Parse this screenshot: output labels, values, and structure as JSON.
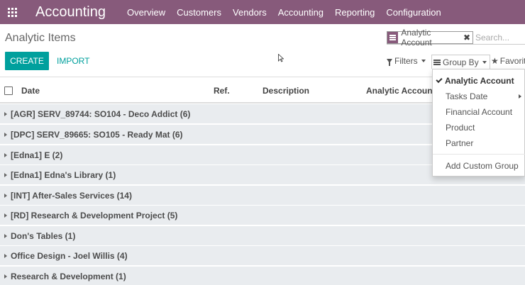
{
  "navbar": {
    "brand": "Accounting",
    "menu": [
      "Overview",
      "Customers",
      "Vendors",
      "Accounting",
      "Reporting",
      "Configuration"
    ]
  },
  "breadcrumb": "Analytic Items",
  "search": {
    "facet_label": "Analytic Account",
    "facet_close": "✖",
    "placeholder": "Search..."
  },
  "buttons": {
    "create": "CREATE",
    "import": "IMPORT"
  },
  "toolbar": {
    "filters": "Filters",
    "group_by": "Group By",
    "favorites": "Favorites"
  },
  "columns": {
    "date": "Date",
    "ref": "Ref.",
    "description": "Description",
    "analytic_account": "Analytic Account"
  },
  "groups": [
    "[AGR] SERV_89744: SO104 - Deco Addict (6)",
    "[DPC] SERV_89665: SO105 - Ready Mat (6)",
    "[Edna1] E (2)",
    "[Edna1] Edna's Library (1)",
    "[INT] After-Sales Services (14)",
    "[RD] Research & Development Project (5)",
    "Don's Tables (1)",
    "Office Design - Joel Willis (4)",
    "Research & Development (1)"
  ],
  "groupby_menu": {
    "checked": "Analytic Account",
    "items": [
      "Tasks Date",
      "Financial Account",
      "Product",
      "Partner"
    ],
    "custom": "Add Custom Group"
  },
  "colors": {
    "navbar": "#875a7b",
    "primary": "#00a09d",
    "group_bg": "#e9ecef"
  }
}
